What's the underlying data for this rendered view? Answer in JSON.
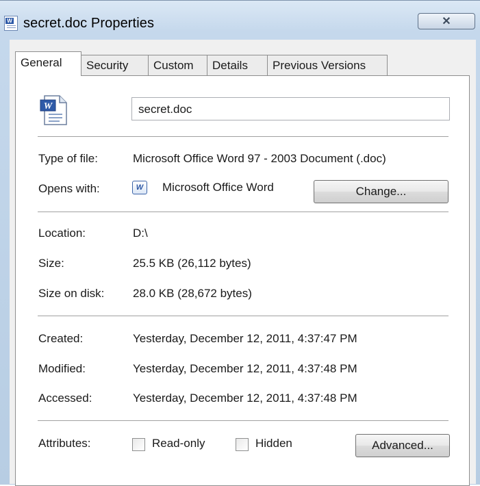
{
  "window": {
    "title": "secret.doc Properties",
    "close_glyph": "✕"
  },
  "tabs": [
    {
      "label": "General",
      "active": true
    },
    {
      "label": "Security",
      "active": false
    },
    {
      "label": "Custom",
      "active": false
    },
    {
      "label": "Details",
      "active": false
    },
    {
      "label": "Previous Versions",
      "active": false
    }
  ],
  "file": {
    "name": "secret.doc",
    "icon": "word-document-icon"
  },
  "properties": {
    "type_label": "Type of file:",
    "type_value": "Microsoft Office Word 97 - 2003 Document (.doc)",
    "opens_label": "Opens with:",
    "opens_icon": "word-app-icon",
    "opens_value": "Microsoft Office Word",
    "change_button": "Change...",
    "location_label": "Location:",
    "location_value": "D:\\",
    "size_label": "Size:",
    "size_value": "25.5 KB (26,112 bytes)",
    "size_on_disk_label": "Size on disk:",
    "size_on_disk_value": "28.0 KB (28,672 bytes)",
    "created_label": "Created:",
    "created_value": "Yesterday, December 12, 2011, 4:37:47 PM",
    "modified_label": "Modified:",
    "modified_value": "Yesterday, December 12, 2011, 4:37:48 PM",
    "accessed_label": "Accessed:",
    "accessed_value": "Yesterday, December 12, 2011, 4:37:48 PM"
  },
  "attributes": {
    "label": "Attributes:",
    "readonly_label": "Read-only",
    "readonly_checked": false,
    "hidden_label": "Hidden",
    "hidden_checked": false,
    "advanced_button": "Advanced..."
  }
}
